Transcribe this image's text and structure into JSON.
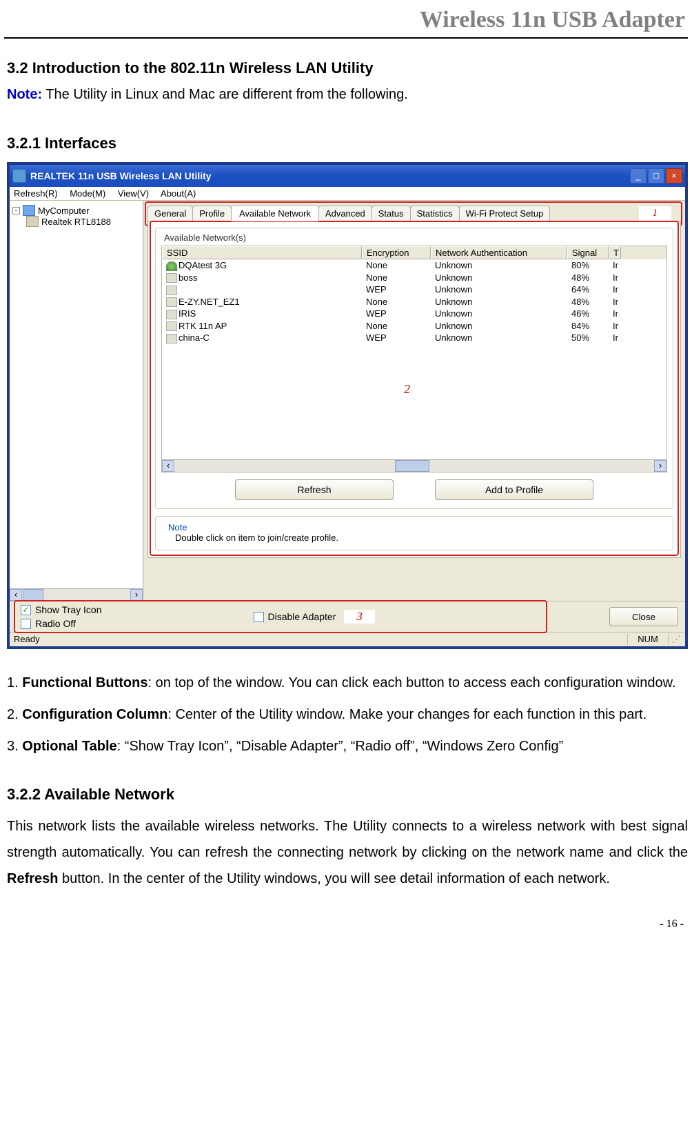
{
  "header": {
    "title": "Wireless 11n USB Adapter"
  },
  "section": {
    "num_title": "3.2    Introduction to the 802.11n Wireless LAN Utility",
    "note_label": "Note:",
    "note_text": " The Utility in Linux and Mac are different from the following."
  },
  "subsection1": {
    "title": "3.2.1    Interfaces"
  },
  "app": {
    "title": "REALTEK 11n USB Wireless LAN Utility",
    "menu": {
      "refresh": "Refresh(R)",
      "mode": "Mode(M)",
      "view": "View(V)",
      "about": "About(A)"
    },
    "tree": {
      "root": "MyComputer",
      "child": "Realtek RTL8188"
    },
    "tabs": [
      "General",
      "Profile",
      "Available Network",
      "Advanced",
      "Status",
      "Statistics",
      "Wi-Fi Protect Setup"
    ],
    "active_tab_index": 2,
    "annot1": "1",
    "fieldset_title": "Available Network(s)",
    "columns": {
      "ssid": "SSID",
      "enc": "Encryption",
      "auth": "Network Authentication",
      "sig": "Signal",
      "t": "T"
    },
    "rows": [
      {
        "icon": "green",
        "ssid": "DQAtest 3G",
        "enc": "None",
        "auth": "Unknown",
        "sig": "80%",
        "t": "Ir"
      },
      {
        "icon": "norm",
        "ssid": "boss",
        "enc": "None",
        "auth": "Unknown",
        "sig": "48%",
        "t": "Ir"
      },
      {
        "icon": "norm",
        "ssid": "",
        "enc": "WEP",
        "auth": "Unknown",
        "sig": "64%",
        "t": "Ir"
      },
      {
        "icon": "norm",
        "ssid": "E-ZY.NET_EZ1",
        "enc": "None",
        "auth": "Unknown",
        "sig": "48%",
        "t": "Ir"
      },
      {
        "icon": "norm",
        "ssid": "IRIS",
        "enc": "WEP",
        "auth": "Unknown",
        "sig": "46%",
        "t": "Ir"
      },
      {
        "icon": "norm",
        "ssid": "RTK 11n AP",
        "enc": "None",
        "auth": "Unknown",
        "sig": "84%",
        "t": "Ir"
      },
      {
        "icon": "norm",
        "ssid": "china-C",
        "enc": "WEP",
        "auth": "Unknown",
        "sig": "50%",
        "t": "Ir"
      }
    ],
    "annot2": "2",
    "buttons": {
      "refresh": "Refresh",
      "add": "Add to Profile"
    },
    "note_title": "Note",
    "note_body": "Double click on item to join/create profile.",
    "checks": {
      "show_tray": "Show Tray Icon",
      "radio_off": "Radio Off",
      "disable_adapter": "Disable Adapter"
    },
    "annot3": "3",
    "close": "Close",
    "status": {
      "ready": "Ready",
      "num": "NUM"
    }
  },
  "list": {
    "li1a": "1. ",
    "li1b": "Functional Buttons",
    "li1c": ": on top of the window. You can click each button to access each configuration window.",
    "li2a": "2. ",
    "li2b": "Configuration Column",
    "li2c": ": Center of the Utility window. Make your changes for each function in this part.",
    "li3a": "3. ",
    "li3b": "Optional Table",
    "li3c": ": “Show Tray Icon”, “Disable Adapter”, “Radio off”, “Windows Zero Config”"
  },
  "subsection2": {
    "title": "3.2.2    Available Network",
    "body1": "This network lists the available wireless networks. The Utility connects to a wireless network with best signal strength automatically. You can refresh the connecting network by clicking on the network name and click the ",
    "body_bold": "Refresh",
    "body2": " button. In the center of the Utility windows, you will see detail information of each network."
  },
  "footer": {
    "page": "- 16 -"
  }
}
